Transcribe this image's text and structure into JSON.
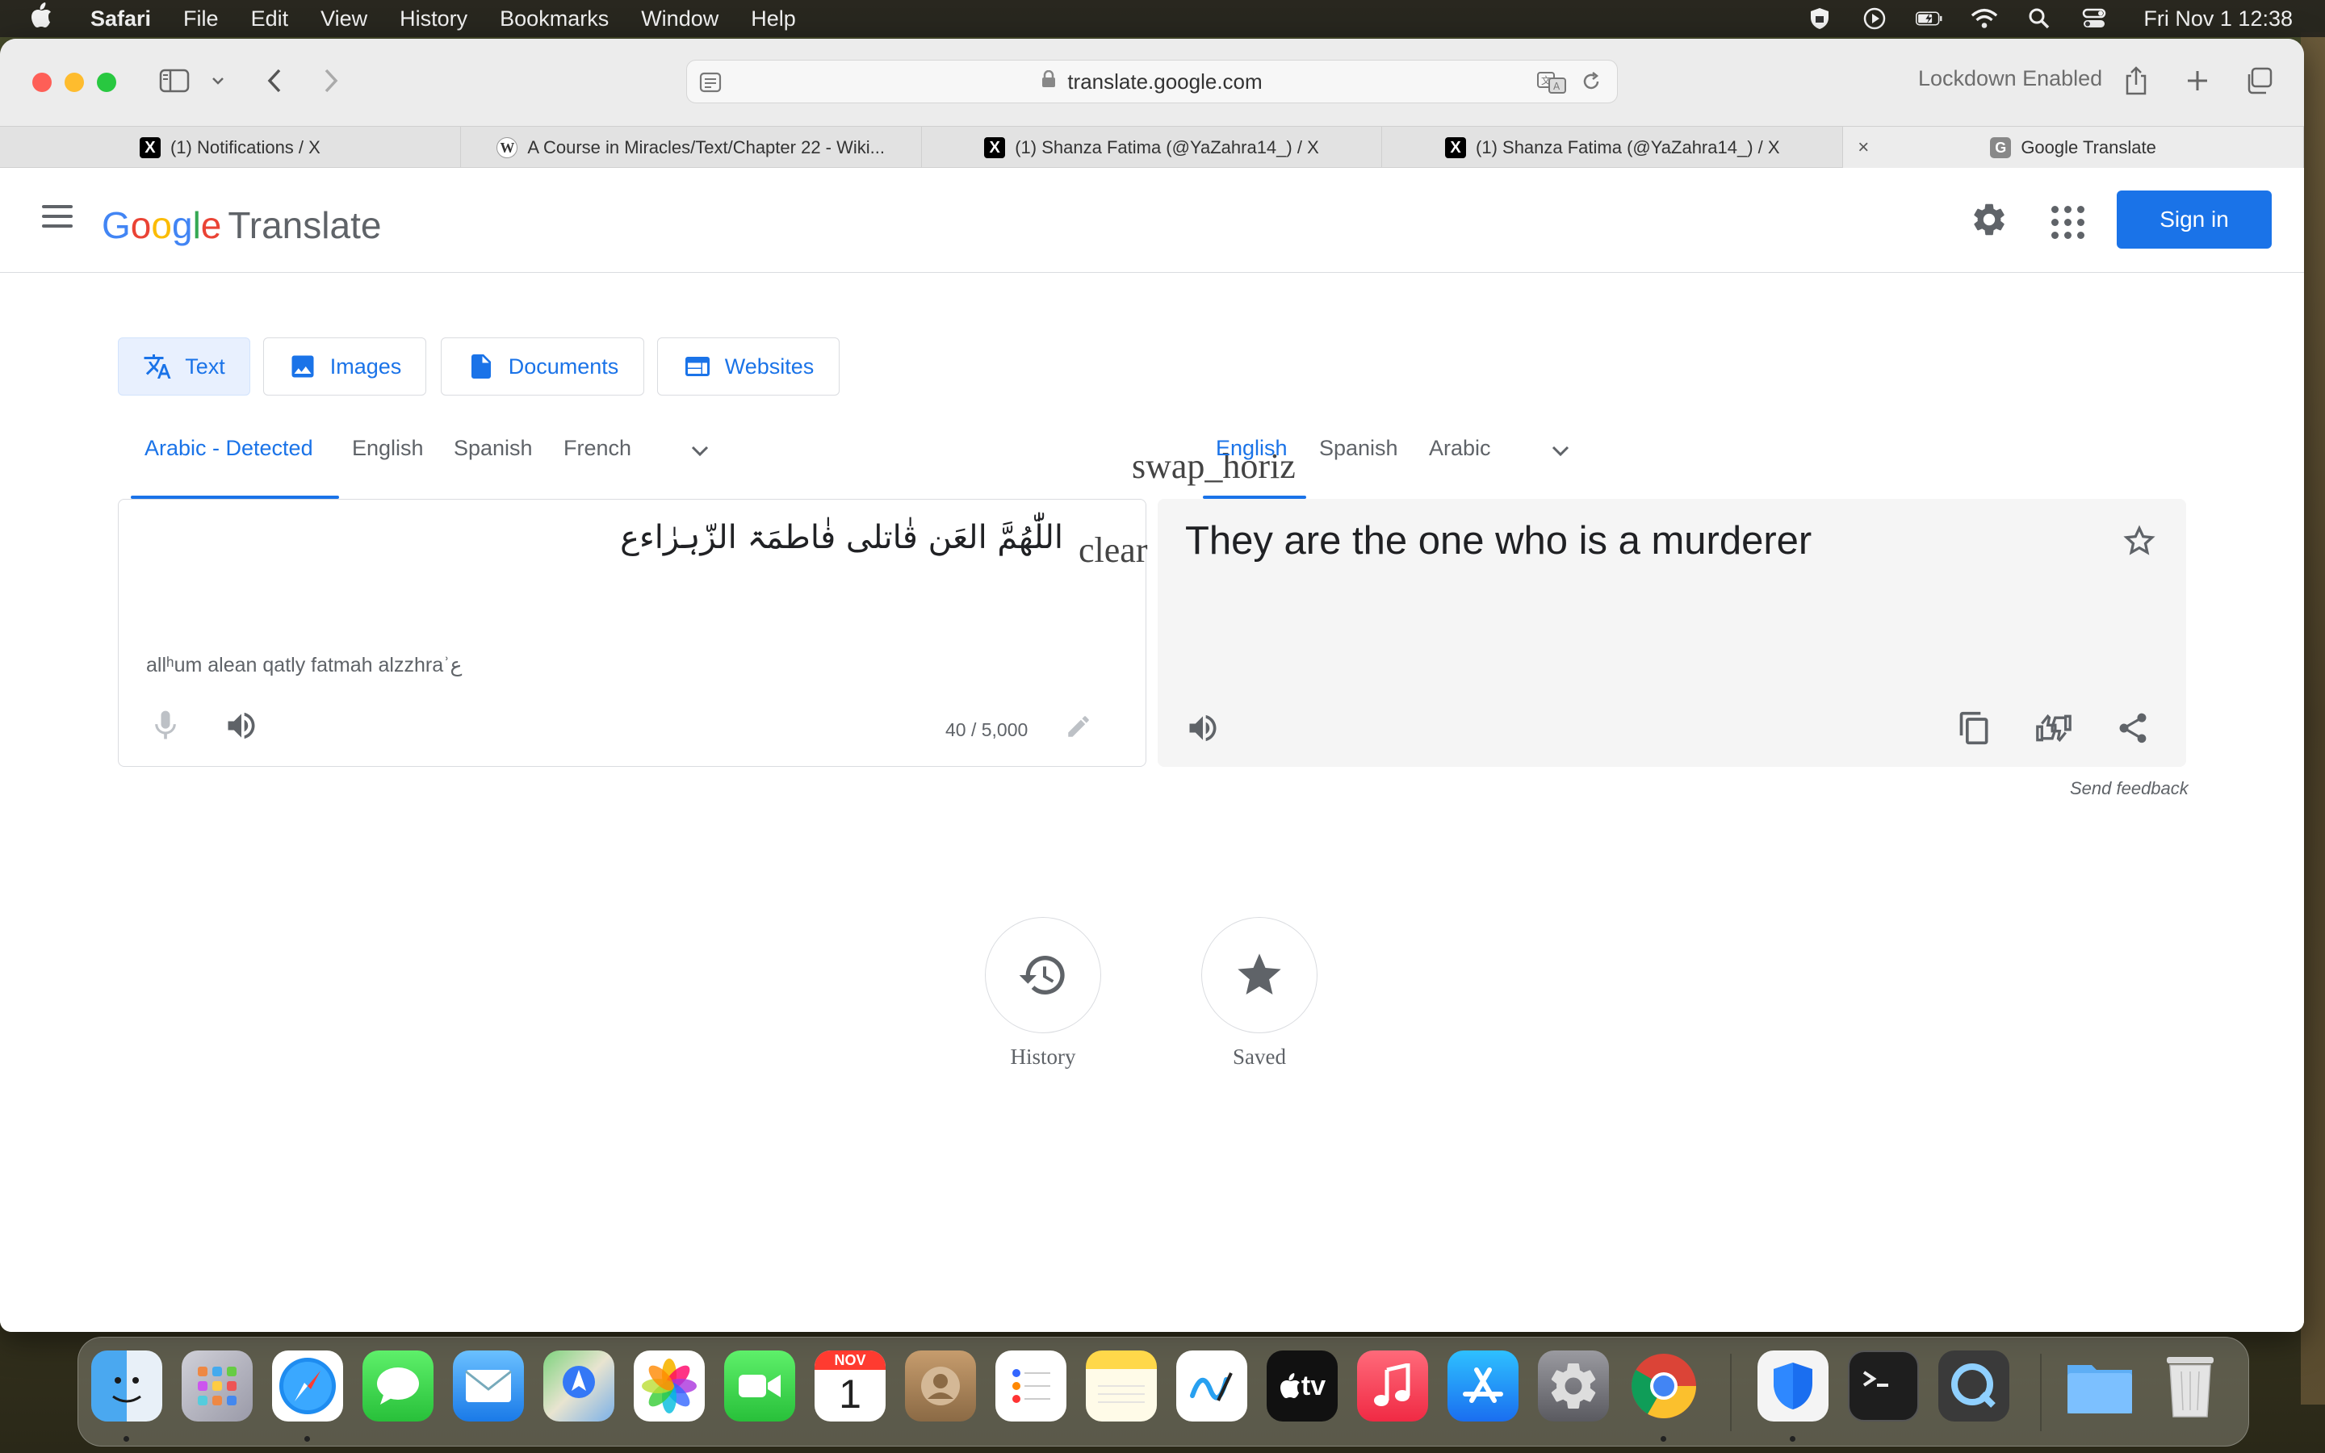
{
  "menubar": {
    "app_name": "Safari",
    "items": [
      "File",
      "Edit",
      "View",
      "History",
      "Bookmarks",
      "Window",
      "Help"
    ],
    "clock": "Fri Nov 1  12:38"
  },
  "browser": {
    "url": "translate.google.com",
    "lockdown_label": "Lockdown Enabled",
    "tabs": [
      {
        "title": "(1) Notifications / X",
        "icon": "x-logo-icon"
      },
      {
        "title": "A Course in Miracles/Text/Chapter 22 - Wiki...",
        "icon": "wikipedia-icon"
      },
      {
        "title": "(1) Shanza Fatima (@YaZahra14_) / X",
        "icon": "x-logo-icon"
      },
      {
        "title": "(1) Shanza Fatima (@YaZahra14_) / X",
        "icon": "x-logo-icon"
      },
      {
        "title": "Google Translate",
        "icon": "google-icon",
        "active": true
      }
    ]
  },
  "header": {
    "logo_google": [
      "G",
      "o",
      "o",
      "g",
      "l",
      "e"
    ],
    "logo_product": "Translate",
    "sign_in": "Sign in"
  },
  "modes": [
    {
      "label": "Text",
      "active": true
    },
    {
      "label": "Images"
    },
    {
      "label": "Documents"
    },
    {
      "label": "Websites"
    }
  ],
  "source_langs": [
    "Arabic - Detected",
    "English",
    "Spanish",
    "French"
  ],
  "target_langs": [
    "English",
    "Spanish",
    "Arabic"
  ],
  "swap_label": "swap_horiz",
  "source": {
    "text": "اللّٰهُمَّ العَن قٰاتلی فٰاطمَۃ الزّہرٰاءع",
    "clear_label": "clear",
    "transliteration": "allʰum alean qatly fatmah alzzhraʾع",
    "char_count": "40 / 5,000"
  },
  "target": {
    "text": "They are the one who is a murderer"
  },
  "send_feedback": "Send feedback",
  "bottom": {
    "history_label": "History",
    "saved_label": "Saved"
  },
  "dock": {
    "calendar_month": "NOV",
    "calendar_day": "1",
    "tv_label": "tv"
  },
  "colors": {
    "accent": "#1a73e8",
    "active_mode_bg": "#e8f0fe"
  }
}
